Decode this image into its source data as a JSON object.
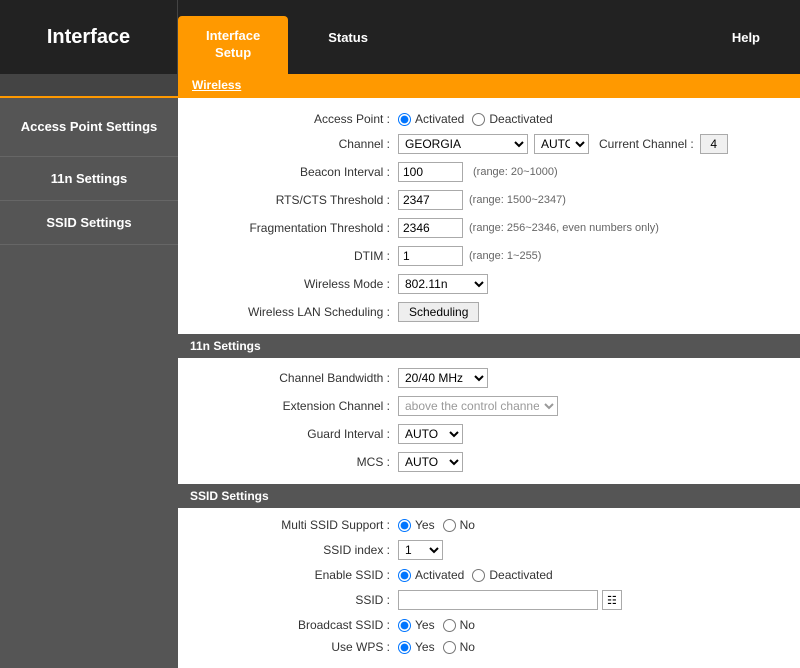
{
  "brand": "Interface",
  "nav": {
    "tabs": [
      {
        "id": "interface-setup",
        "label": "Interface\nSetup",
        "active": true
      },
      {
        "id": "status",
        "label": "Status",
        "active": false
      },
      {
        "id": "help",
        "label": "Help",
        "active": false
      }
    ]
  },
  "sub_nav": {
    "items": [
      {
        "id": "wireless",
        "label": "Wireless",
        "active": true
      }
    ]
  },
  "sections": {
    "access_point": {
      "label": "Access Point Settings",
      "fields": {
        "access_point": {
          "label": "Access Point :",
          "options": [
            "Activated",
            "Deactivated"
          ],
          "selected": "Activated"
        },
        "channel": {
          "label": "Channel :",
          "value": "GEORGIA",
          "auto_value": "AUTO",
          "current_channel_label": "Current Channel :",
          "current_channel_value": "4"
        },
        "beacon_interval": {
          "label": "Beacon Interval :",
          "value": "100",
          "hint": "(range: 20~1000)"
        },
        "rts_cts": {
          "label": "RTS/CTS Threshold :",
          "value": "2347",
          "hint": "(range: 1500~2347)"
        },
        "fragmentation": {
          "label": "Fragmentation Threshold :",
          "value": "2346",
          "hint": "(range: 256~2346, even numbers only)"
        },
        "dtim": {
          "label": "DTIM :",
          "value": "1",
          "hint": "(range: 1~255)"
        },
        "wireless_mode": {
          "label": "Wireless Mode :",
          "value": "802.11n"
        },
        "wireless_lan": {
          "label": "Wireless LAN Scheduling :",
          "btn_label": "Scheduling"
        }
      }
    },
    "settings_11n": {
      "label": "11n Settings",
      "fields": {
        "channel_bandwidth": {
          "label": "Channel Bandwidth :",
          "value": "20/40 MHz"
        },
        "extension_channel": {
          "label": "Extension Channel :",
          "value": "above the control channel"
        },
        "guard_interval": {
          "label": "Guard Interval :",
          "value": "AUTO"
        },
        "mcs": {
          "label": "MCS :",
          "value": "AUTO"
        }
      }
    },
    "ssid": {
      "label": "SSID Settings",
      "fields": {
        "multi_ssid": {
          "label": "Multi SSID Support :",
          "options": [
            "Yes",
            "No"
          ],
          "selected": "Yes"
        },
        "ssid_index": {
          "label": "SSID index :",
          "value": "1"
        },
        "enable_ssid": {
          "label": "Enable SSID :",
          "options": [
            "Activated",
            "Deactivated"
          ],
          "selected": "Activated"
        },
        "ssid": {
          "label": "SSID :",
          "value": ""
        },
        "broadcast_ssid": {
          "label": "Broadcast SSID :",
          "options": [
            "Yes",
            "No"
          ],
          "selected": "Yes"
        },
        "use_wps": {
          "label": "Use WPS :",
          "options": [
            "Yes",
            "No"
          ],
          "selected": "Yes"
        }
      }
    }
  }
}
